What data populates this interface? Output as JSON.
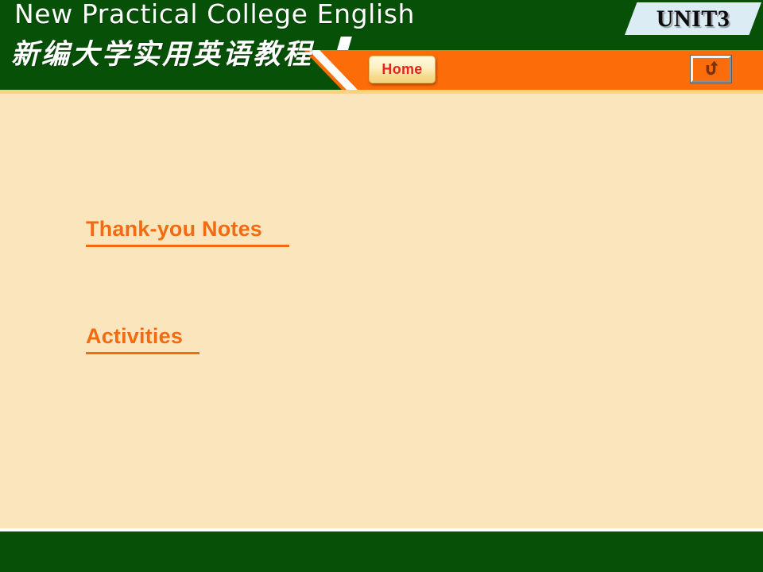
{
  "header": {
    "title_en": "New Practical College English",
    "title_cn": "新编大学实用英语教程",
    "unit_badge": "UNIT3",
    "colors": {
      "green": "#075007",
      "orange": "#fc6c08",
      "cream": "#fbe5bd",
      "badge_blue": "#dcecf5",
      "link_orange": "#f36b10",
      "home_text_red": "#e8221c"
    }
  },
  "toolbar": {
    "home_label": "Home",
    "home_icon": "home-button",
    "return_icon": "return-arrow-icon"
  },
  "content": {
    "links": [
      {
        "label": "Thank-you Notes",
        "name": "link-thankyou"
      },
      {
        "label": "Activities",
        "name": "link-activities"
      }
    ]
  },
  "footer": {
    "text": ""
  }
}
